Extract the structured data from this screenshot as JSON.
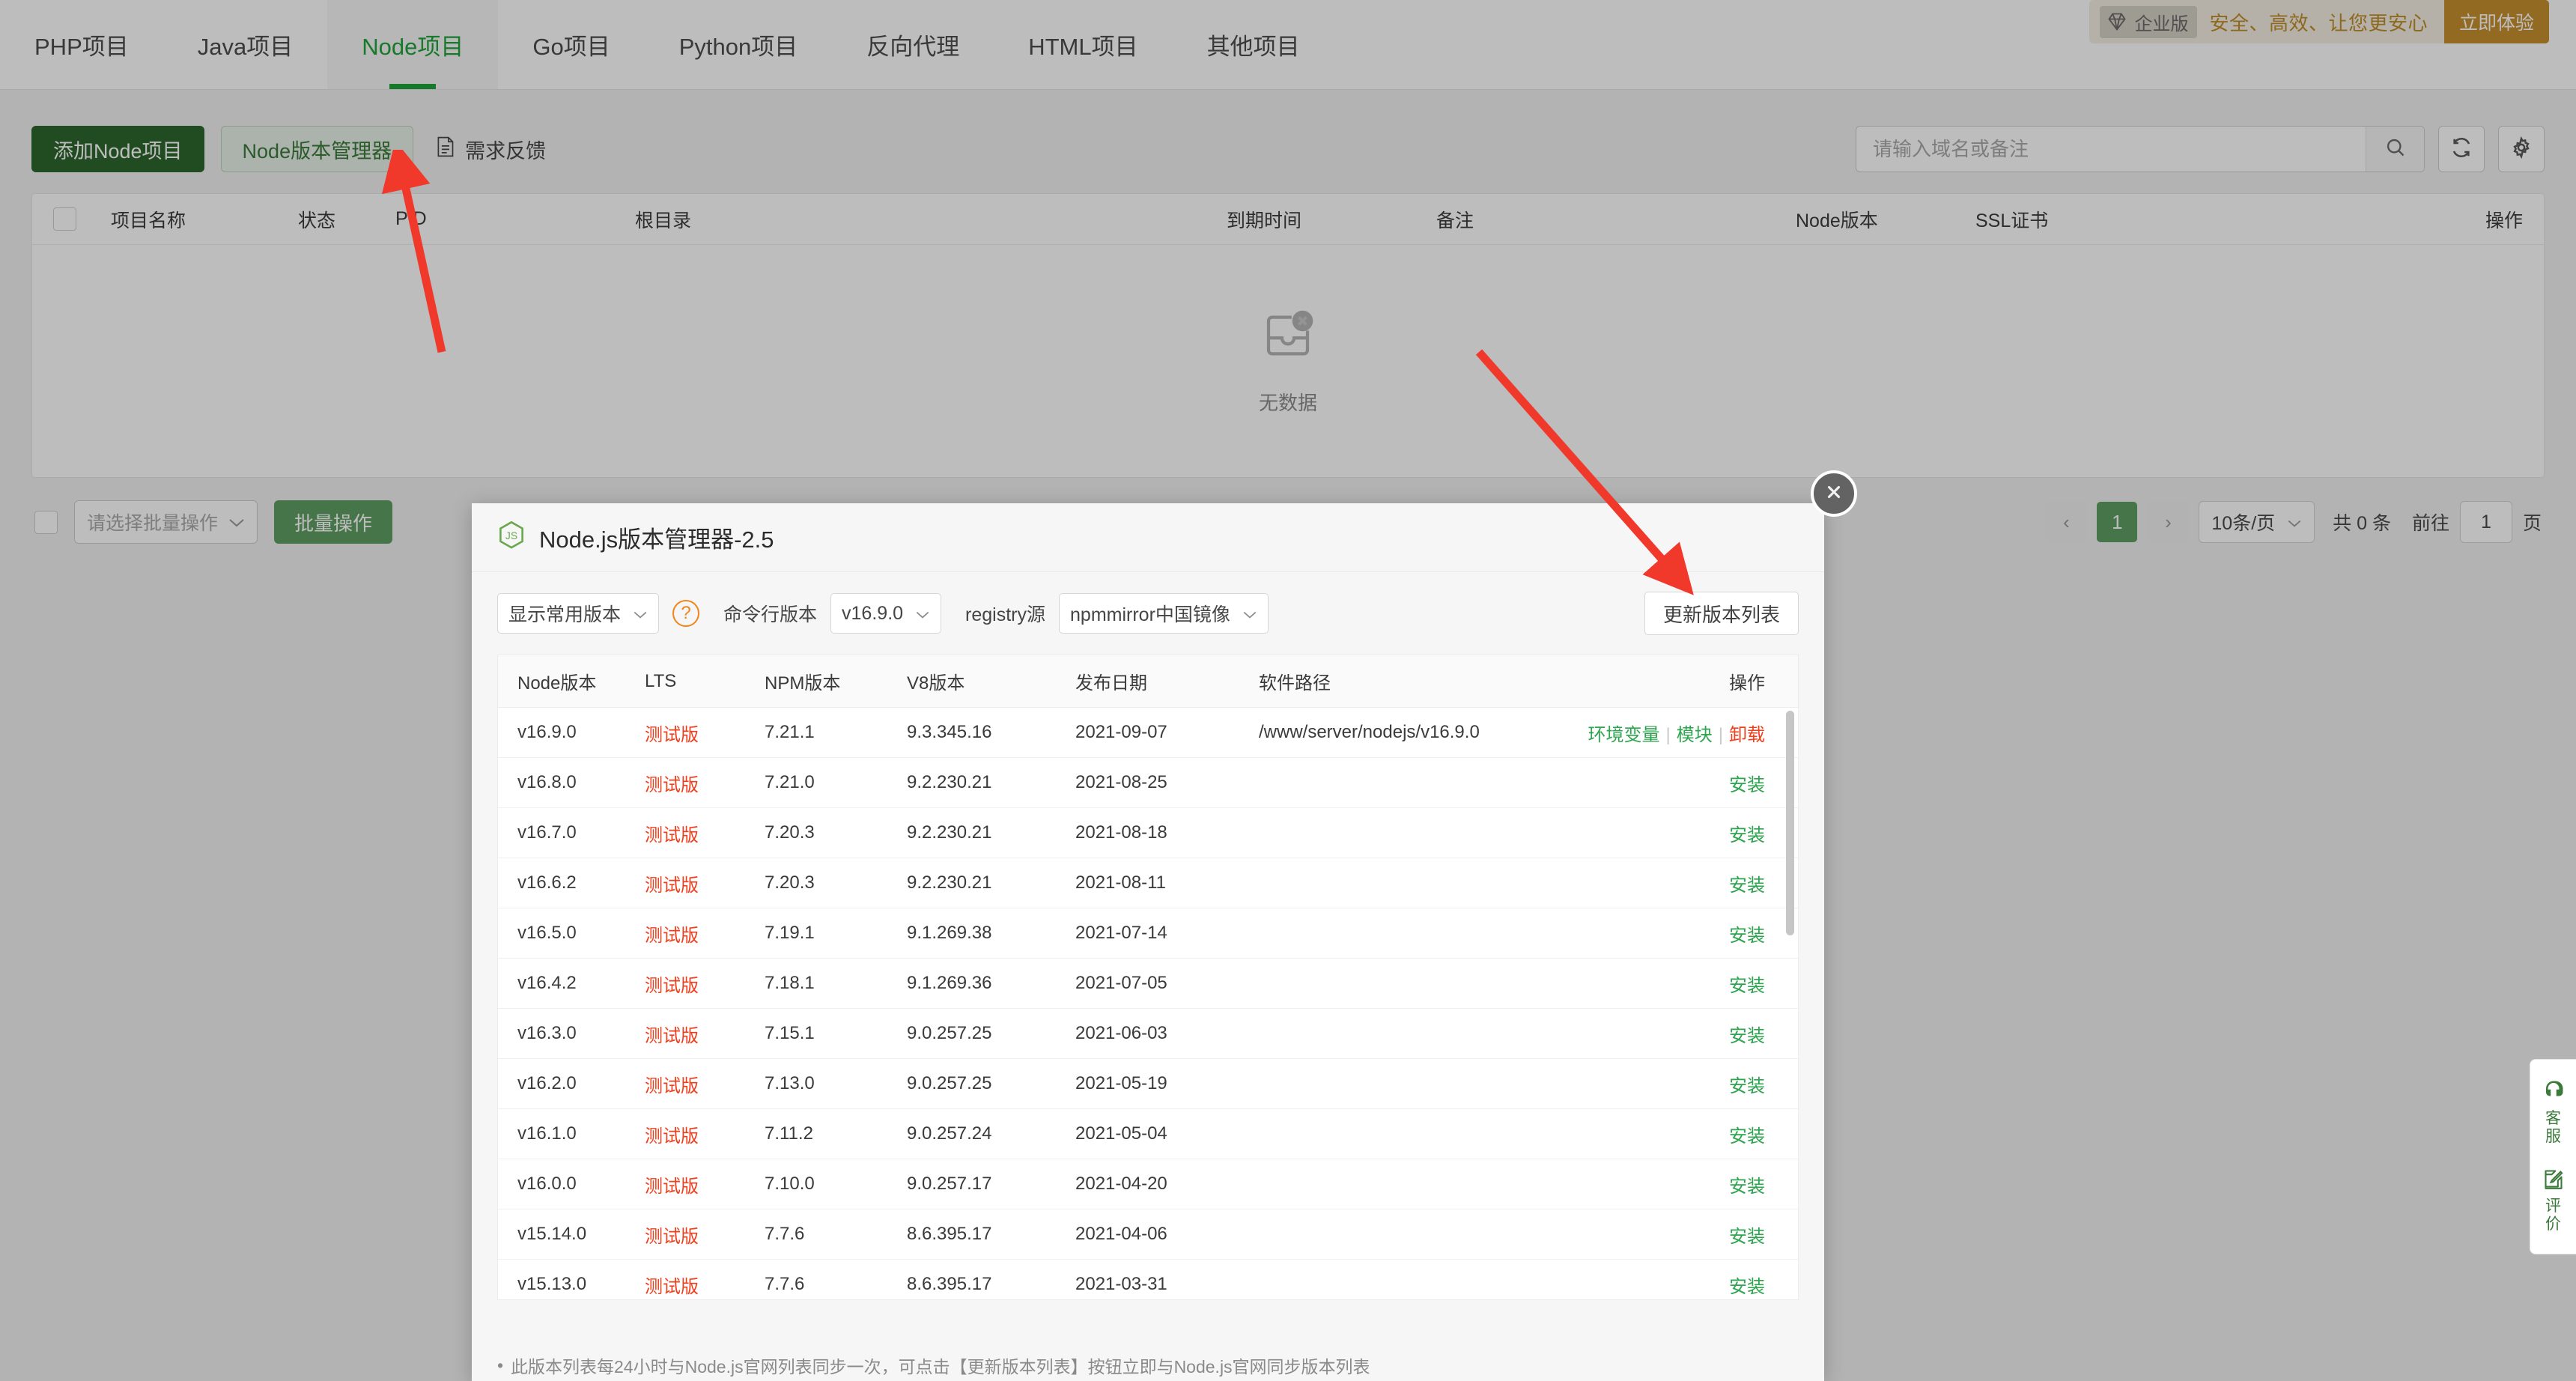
{
  "tabs": [
    {
      "label": "PHP项目",
      "active": false
    },
    {
      "label": "Java项目",
      "active": false
    },
    {
      "label": "Node项目",
      "active": true
    },
    {
      "label": "Go项目",
      "active": false
    },
    {
      "label": "Python项目",
      "active": false
    },
    {
      "label": "反向代理",
      "active": false
    },
    {
      "label": "HTML项目",
      "active": false
    },
    {
      "label": "其他项目",
      "active": false
    }
  ],
  "promo": {
    "badge": "企业版",
    "text": "安全、高效、让您更安心",
    "button": "立即体验",
    "icon": "diamond-icon",
    "accent": "#c7902f"
  },
  "toolbar": {
    "add_project": "添加Node项目",
    "version_manager": "Node版本管理器",
    "feedback": "需求反馈",
    "search_placeholder": "请输入域名或备注",
    "search_value": "",
    "search_icon": "search-icon",
    "refresh_icon": "refresh-icon",
    "settings_icon": "gear-icon"
  },
  "table": {
    "columns": [
      "项目名称",
      "状态",
      "PID",
      "根目录",
      "到期时间",
      "备注",
      "Node版本",
      "SSL证书",
      "操作"
    ],
    "empty_text": "无数据",
    "empty_icon": "empty-box-icon"
  },
  "bulk": {
    "select_placeholder": "请选择批量操作",
    "button": "批量操作"
  },
  "pagination": {
    "prev": "‹",
    "current_page": "1",
    "next": "›",
    "page_size": "10条/页",
    "total_label": "共 0 条",
    "goto_label": "前往",
    "goto_value": "1",
    "page_unit": "页"
  },
  "modal": {
    "title": "Node.js版本管理器-2.5",
    "logo_icon": "nodejs-icon",
    "close_icon": "close-icon",
    "filter_select": "显示常用版本",
    "help_icon": "question-icon",
    "cli_label": "命令行版本",
    "cli_version": "v16.9.0",
    "registry_label": "registry源",
    "registry_value": "npmmirror中国镜像",
    "update_button": "更新版本列表",
    "footer_note": "此版本列表每24小时与Node.js官网列表同步一次，可点击【更新版本列表】按钮立即与Node.js官网同步版本列表",
    "columns": [
      "Node版本",
      "LTS",
      "NPM版本",
      "V8版本",
      "发布日期",
      "软件路径",
      "操作"
    ],
    "action_installed": [
      "环境变量",
      "模块",
      "卸载"
    ],
    "action_install": "安装",
    "rows": [
      {
        "version": "v16.9.0",
        "lts": "测试版",
        "npm": "7.21.1",
        "v8": "9.3.345.16",
        "date": "2021-09-07",
        "path": "/www/server/nodejs/v16.9.0",
        "installed": true
      },
      {
        "version": "v16.8.0",
        "lts": "测试版",
        "npm": "7.21.0",
        "v8": "9.2.230.21",
        "date": "2021-08-25",
        "path": "",
        "installed": false
      },
      {
        "version": "v16.7.0",
        "lts": "测试版",
        "npm": "7.20.3",
        "v8": "9.2.230.21",
        "date": "2021-08-18",
        "path": "",
        "installed": false
      },
      {
        "version": "v16.6.2",
        "lts": "测试版",
        "npm": "7.20.3",
        "v8": "9.2.230.21",
        "date": "2021-08-11",
        "path": "",
        "installed": false
      },
      {
        "version": "v16.5.0",
        "lts": "测试版",
        "npm": "7.19.1",
        "v8": "9.1.269.38",
        "date": "2021-07-14",
        "path": "",
        "installed": false
      },
      {
        "version": "v16.4.2",
        "lts": "测试版",
        "npm": "7.18.1",
        "v8": "9.1.269.36",
        "date": "2021-07-05",
        "path": "",
        "installed": false
      },
      {
        "version": "v16.3.0",
        "lts": "测试版",
        "npm": "7.15.1",
        "v8": "9.0.257.25",
        "date": "2021-06-03",
        "path": "",
        "installed": false
      },
      {
        "version": "v16.2.0",
        "lts": "测试版",
        "npm": "7.13.0",
        "v8": "9.0.257.25",
        "date": "2021-05-19",
        "path": "",
        "installed": false
      },
      {
        "version": "v16.1.0",
        "lts": "测试版",
        "npm": "7.11.2",
        "v8": "9.0.257.24",
        "date": "2021-05-04",
        "path": "",
        "installed": false
      },
      {
        "version": "v16.0.0",
        "lts": "测试版",
        "npm": "7.10.0",
        "v8": "9.0.257.17",
        "date": "2021-04-20",
        "path": "",
        "installed": false
      },
      {
        "version": "v15.14.0",
        "lts": "测试版",
        "npm": "7.7.6",
        "v8": "8.6.395.17",
        "date": "2021-04-06",
        "path": "",
        "installed": false
      },
      {
        "version": "v15.13.0",
        "lts": "测试版",
        "npm": "7.7.6",
        "v8": "8.6.395.17",
        "date": "2021-03-31",
        "path": "",
        "installed": false
      }
    ]
  },
  "side_widget": {
    "items": [
      {
        "label": "客服",
        "icon": "headset-icon"
      },
      {
        "label": "评价",
        "icon": "edit-square-icon"
      }
    ]
  }
}
